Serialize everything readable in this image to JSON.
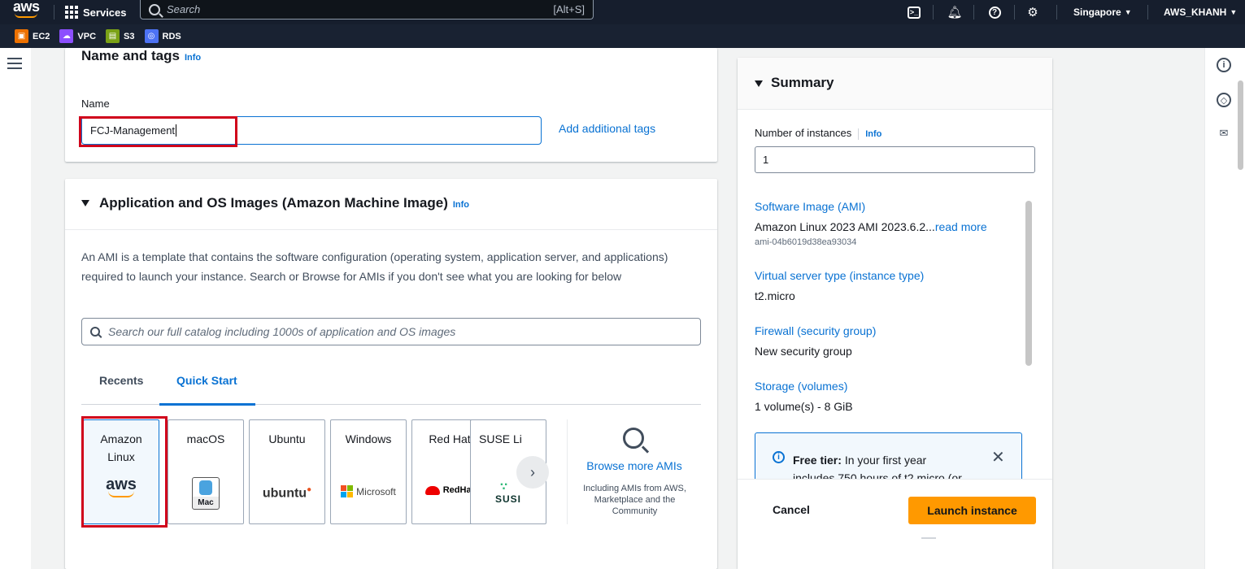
{
  "topnav": {
    "logo": "aws",
    "services_label": "Services",
    "search_placeholder": "Search",
    "search_shortcut": "[Alt+S]",
    "region": "Singapore",
    "account": "AWS_KHANH"
  },
  "favorites": [
    {
      "label": "EC2",
      "icon": "ec2-icon",
      "color": "#ed7100"
    },
    {
      "label": "VPC",
      "icon": "vpc-icon",
      "color": "#8c4fff"
    },
    {
      "label": "S3",
      "icon": "s3-icon",
      "color": "#7aa116"
    },
    {
      "label": "RDS",
      "icon": "rds-icon",
      "color": "#4d72f3"
    }
  ],
  "name_tags": {
    "heading": "Name and tags",
    "info": "Info",
    "name_label": "Name",
    "name_value": "FCJ-Management",
    "add_tags": "Add additional tags"
  },
  "ami": {
    "heading": "Application and OS Images (Amazon Machine Image)",
    "info": "Info",
    "description": "An AMI is a template that contains the software configuration (operating system, application server, and applications) required to launch your instance. Search or Browse for AMIs if you don't see what you are looking for below",
    "search_placeholder": "Search our full catalog including 1000s of application and OS images",
    "tabs": [
      "Recents",
      "Quick Start"
    ],
    "active_tab": "Quick Start",
    "os_tiles": [
      {
        "name": "Amazon Linux",
        "logo": "aws",
        "selected": true
      },
      {
        "name": "macOS",
        "logo": "Mac"
      },
      {
        "name": "Ubuntu",
        "logo": "ubuntu"
      },
      {
        "name": "Windows",
        "logo": "Microsoft"
      },
      {
        "name": "Red Hat",
        "logo": "RedHat"
      },
      {
        "name": "SUSE Li",
        "logo": "SUSI"
      }
    ],
    "browse_link": "Browse more AMIs",
    "browse_sub": "Including AMIs from AWS, Marketplace and the Community"
  },
  "summary": {
    "heading": "Summary",
    "instances_label": "Number of instances",
    "instances_info": "Info",
    "instances_value": "1",
    "software_image_label": "Software Image (AMI)",
    "software_image_value": "Amazon Linux 2023 AMI 2023.6.2...",
    "read_more": "read more",
    "ami_id": "ami-04b6019d38ea93034",
    "instance_type_label": "Virtual server type (instance type)",
    "instance_type_value": "t2.micro",
    "firewall_label": "Firewall (security group)",
    "firewall_value": "New security group",
    "storage_label": "Storage (volumes)",
    "storage_value": "1 volume(s) - 8 GiB",
    "free_tier_bold": "Free tier:",
    "free_tier_text": "In your first year",
    "free_tier_more": "includes 750 hours of t2.micro (or",
    "cancel": "Cancel",
    "launch": "Launch instance"
  }
}
